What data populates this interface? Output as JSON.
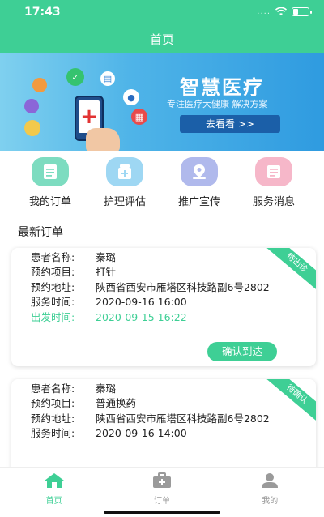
{
  "status_bar": {
    "time": "17:43",
    "dots": "...."
  },
  "nav": {
    "title": "首页"
  },
  "banner": {
    "title": "智慧医疗",
    "subtitle": "专注医疗大健康 解决方案",
    "button_label": "去看看 >>"
  },
  "menu": [
    {
      "label": "我的订单",
      "icon": "clipboard-icon",
      "color": "#7ddcc0"
    },
    {
      "label": "护理评估",
      "icon": "medicine-icon",
      "color": "#9ed7f3"
    },
    {
      "label": "推广宣传",
      "icon": "location-icon",
      "color": "#b0b9ec"
    },
    {
      "label": "服务消息",
      "icon": "message-icon",
      "color": "#f6b7c9"
    }
  ],
  "section_title": "最新订单",
  "orders": [
    {
      "status": "待出诊",
      "rows": [
        {
          "k": "患者名称:",
          "v": "秦璐"
        },
        {
          "k": "预约项目:",
          "v": "打针"
        },
        {
          "k": "预约地址:",
          "v": "陕西省西安市雁塔区科技路副6号2802"
        },
        {
          "k": "服务时间:",
          "v": "2020-09-16 16:00"
        },
        {
          "k": "出发时间:",
          "v": "2020-09-15 16:22"
        }
      ],
      "action_label": "确认到达"
    },
    {
      "status": "待确认",
      "rows": [
        {
          "k": "患者名称:",
          "v": "秦璐"
        },
        {
          "k": "预约项目:",
          "v": "普通换药"
        },
        {
          "k": "预约地址:",
          "v": "陕西省西安市雁塔区科技路副6号2802"
        },
        {
          "k": "服务时间:",
          "v": "2020-09-16 14:00"
        }
      ]
    }
  ],
  "tabs": [
    {
      "label": "首页",
      "icon": "home-icon",
      "active": true
    },
    {
      "label": "订单",
      "icon": "medical-kit-icon",
      "active": false
    },
    {
      "label": "我的",
      "icon": "user-icon",
      "active": false
    }
  ],
  "colors": {
    "primary": "#3ecf95",
    "inactive": "#9a9a9a"
  }
}
